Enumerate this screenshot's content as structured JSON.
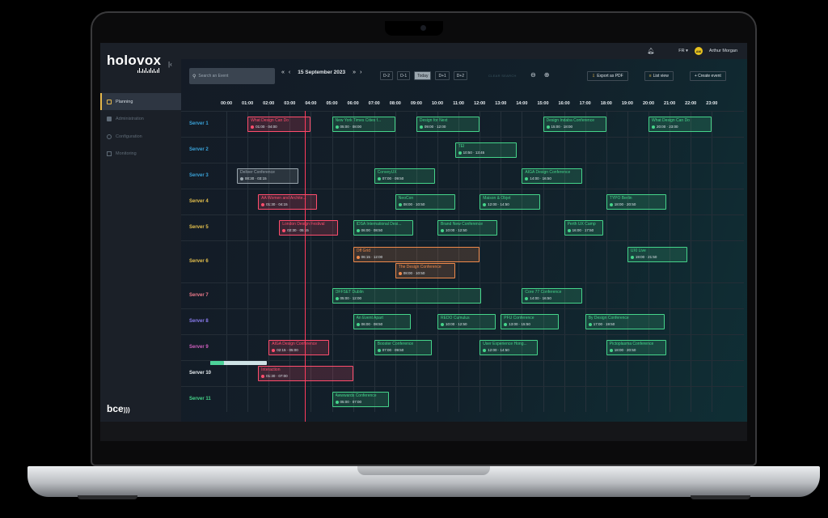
{
  "app": {
    "logo": "holovox",
    "brand": "bce"
  },
  "topbar": {
    "language": "FR",
    "user_initials": "AM",
    "user_name": "Arthur Morgan"
  },
  "sidebar": {
    "items": [
      "Planning",
      "Administration",
      "Configuration",
      "Monitoring"
    ],
    "active": 0
  },
  "toolbar": {
    "search_placeholder": "Search an Event",
    "date": "15 September 2023",
    "day_buttons": [
      "D-2",
      "D-1",
      "Today",
      "D+1",
      "D+2"
    ],
    "active_day": 2,
    "clear_label": "CLEAR SEARCH",
    "export_label": "Export as PDF",
    "list_label": "List view",
    "create_label": "+ Create event"
  },
  "hours": [
    "00:00",
    "01:00",
    "02:00",
    "03:00",
    "04:00",
    "05:00",
    "06:00",
    "07:00",
    "08:00",
    "09:00",
    "10:00",
    "11:00",
    "12:00",
    "13:00",
    "14:00",
    "15:00",
    "16:00",
    "17:00",
    "18:00",
    "19:00",
    "20:00",
    "21:00",
    "22:00",
    "23:00"
  ],
  "now_hour": 3.72,
  "colors": {
    "green": "#45d48a",
    "red": "#ff4d6d",
    "orange": "#f08a4b",
    "gray": "#9aa6ae"
  },
  "rows": [
    {
      "label": "Server 1",
      "color": "#3aa3d9",
      "events": [
        {
          "name": "What Design Can Do",
          "time": "01:00 · 04:00",
          "start": 1.0,
          "end": 4.0,
          "level": 0,
          "status": "red"
        },
        {
          "name": "New York Times Cities f...",
          "time": "05:00 · 08:00",
          "start": 5.0,
          "end": 8.0,
          "level": 0,
          "status": "green"
        },
        {
          "name": "Design for Next",
          "time": "09:00 · 12:00",
          "start": 9.0,
          "end": 12.0,
          "level": 0,
          "status": "green"
        },
        {
          "name": "Design Indaba Conference",
          "time": "15:00 · 18:00",
          "start": 15.0,
          "end": 18.0,
          "level": 0,
          "status": "green"
        },
        {
          "name": "What Design Can Do",
          "time": "20:00 · 23:00",
          "start": 20.0,
          "end": 23.0,
          "level": 0,
          "status": "green"
        }
      ]
    },
    {
      "label": "Server 2",
      "color": "#3aa3d9",
      "events": [
        {
          "name": "TEI",
          "time": "10:50 · 13:45",
          "start": 10.83,
          "end": 13.75,
          "level": 0,
          "status": "green"
        }
      ]
    },
    {
      "label": "Server 3",
      "color": "#3aa3d9",
      "events": [
        {
          "name": "Deliver Conference",
          "time": "00:30 · 03:15",
          "start": 0.5,
          "end": 3.4,
          "level": 0,
          "status": "gray"
        },
        {
          "name": "ConveyUX",
          "time": "07:00 · 09:50",
          "start": 7.0,
          "end": 9.9,
          "level": 0,
          "status": "green"
        },
        {
          "name": "AIGA Design Conference",
          "time": "14:00 · 16:50",
          "start": 14.0,
          "end": 16.85,
          "level": 0,
          "status": "green"
        }
      ]
    },
    {
      "label": "Server 4",
      "color": "#e6c14d",
      "events": [
        {
          "name": "AA Women and Archite...",
          "time": "01:30 · 04:15",
          "start": 1.5,
          "end": 4.3,
          "level": 0,
          "status": "red"
        },
        {
          "name": "NeoCon",
          "time": "08:00 · 10:50",
          "start": 8.0,
          "end": 10.85,
          "level": 0,
          "status": "green"
        },
        {
          "name": "Maison & Objet",
          "time": "12:00 · 14:50",
          "start": 12.0,
          "end": 14.85,
          "level": 0,
          "status": "green"
        },
        {
          "name": "TYPO Berlin",
          "time": "18:00 · 20:50",
          "start": 18.0,
          "end": 20.85,
          "level": 0,
          "status": "green"
        }
      ]
    },
    {
      "label": "Server 5",
      "color": "#e6c14d",
      "events": [
        {
          "name": "London Design Festival",
          "time": "02:30 · 05:15",
          "start": 2.5,
          "end": 5.3,
          "level": 0,
          "status": "red"
        },
        {
          "name": "IDSA International Desi...",
          "time": "06:00 · 08:50",
          "start": 6.0,
          "end": 8.85,
          "level": 0,
          "status": "green"
        },
        {
          "name": "Brand New Conference",
          "time": "10:00 · 12:50",
          "start": 10.0,
          "end": 12.85,
          "level": 0,
          "status": "green"
        },
        {
          "name": "Perth UX Camp",
          "time": "16:00 · 17:50",
          "start": 16.0,
          "end": 17.85,
          "level": 0,
          "status": "green"
        }
      ]
    },
    {
      "label": "Server 6",
      "color": "#e6c14d",
      "events": [
        {
          "name": "Off Grid",
          "time": "06:15 · 12:00",
          "start": 6.0,
          "end": 12.0,
          "level": 0,
          "status": "orange"
        },
        {
          "name": "The Design Conference",
          "time": "08:00 · 10:50",
          "start": 8.0,
          "end": 10.85,
          "level": 1,
          "status": "orange"
        },
        {
          "name": "UXI Live",
          "time": "19:00 · 21:50",
          "start": 19.0,
          "end": 21.85,
          "level": 0,
          "status": "green"
        }
      ]
    },
    {
      "label": "Server 7",
      "color": "#f07b8c",
      "events": [
        {
          "name": "OFFSET Dublin",
          "time": "05:00 · 12:00",
          "start": 5.0,
          "end": 12.05,
          "level": 0,
          "status": "green"
        },
        {
          "name": "Core 77 Conference",
          "time": "14:00 · 16:50",
          "start": 14.0,
          "end": 16.85,
          "level": 0,
          "status": "green"
        }
      ]
    },
    {
      "label": "Server 8",
      "color": "#8a7cf0",
      "events": [
        {
          "name": "An Event Apart",
          "time": "06:00 · 08:50",
          "start": 6.0,
          "end": 8.75,
          "level": 0,
          "status": "green"
        },
        {
          "name": "REDO Cumulus",
          "time": "10:00 · 12:50",
          "start": 10.0,
          "end": 12.75,
          "level": 0,
          "status": "green"
        },
        {
          "name": "PFU Conference",
          "time": "13:00 · 15:50",
          "start": 13.0,
          "end": 15.75,
          "level": 0,
          "status": "green"
        },
        {
          "name": "By Design Conference",
          "time": "17:00 · 19:50",
          "start": 17.0,
          "end": 20.75,
          "level": 0,
          "status": "green"
        }
      ]
    },
    {
      "label": "Server 9",
      "color": "#d05fbf",
      "events": [
        {
          "name": "AIGA Design Conference",
          "time": "02:15 · 05:00",
          "start": 2.0,
          "end": 4.85,
          "level": 0,
          "status": "red"
        },
        {
          "name": "Booster Conference",
          "time": "07:00 · 09:50",
          "start": 7.0,
          "end": 9.75,
          "level": 0,
          "status": "green"
        },
        {
          "name": "User Experience Hong...",
          "time": "12:00 · 14:50",
          "start": 12.0,
          "end": 14.75,
          "level": 0,
          "status": "green"
        },
        {
          "name": "Pictoplasma Conference",
          "time": "18:00 · 20:50",
          "start": 18.0,
          "end": 20.85,
          "level": 0,
          "status": "green"
        }
      ]
    },
    {
      "label": "Server 10",
      "color": "#e6ecf0",
      "events": [
        {
          "name": "Interaction",
          "time": "01:30 · 07:00",
          "start": 1.5,
          "end": 6.0,
          "level": 0,
          "status": "red"
        }
      ]
    },
    {
      "label": "Server 11",
      "color": "#45d48a",
      "events": [
        {
          "name": "Awwwards Conference",
          "time": "05:00 · 07:00",
          "start": 5.0,
          "end": 7.7,
          "level": 0,
          "status": "green"
        }
      ]
    }
  ]
}
